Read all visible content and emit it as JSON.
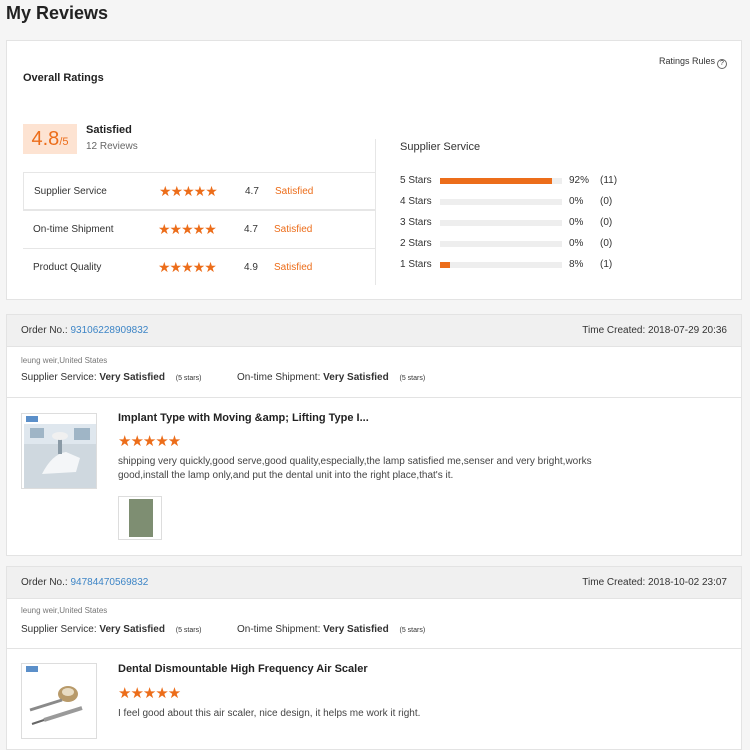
{
  "page": {
    "title": "My Reviews"
  },
  "overall": {
    "title": "Overall Ratings",
    "rules_label": "Ratings Rules",
    "score": "4.8",
    "outof": "/5",
    "label": "Satisfied",
    "count": "12 Reviews"
  },
  "metrics": [
    {
      "name": "Supplier Service",
      "stars": 4.7,
      "score": "4.7",
      "status": "Satisfied"
    },
    {
      "name": "On-time Shipment",
      "stars": 4.7,
      "score": "4.7",
      "status": "Satisfied"
    },
    {
      "name": "Product Quality",
      "stars": 4.9,
      "score": "4.9",
      "status": "Satisfied"
    }
  ],
  "distribution": {
    "title": "Supplier Service",
    "rows": [
      {
        "label": "5 Stars",
        "pct": "92%",
        "count": "(11)",
        "fraction": 0.92
      },
      {
        "label": "4 Stars",
        "pct": "0%",
        "count": "(0)",
        "fraction": 0
      },
      {
        "label": "3 Stars",
        "pct": "0%",
        "count": "(0)",
        "fraction": 0
      },
      {
        "label": "2 Stars",
        "pct": "0%",
        "count": "(0)",
        "fraction": 0
      },
      {
        "label": "1 Stars",
        "pct": "8%",
        "count": "(1)",
        "fraction": 0.08
      }
    ]
  },
  "orders": [
    {
      "order_label": "Order No.:",
      "order_no": "93106228909832",
      "time": "Time Created: 2018-07-29 20:36",
      "reviewer": "leung weir,United States",
      "service_label": "Supplier Service:",
      "service_value": "Very Satisfied",
      "service_stars": "(5 stars)",
      "shipment_label": "On-time Shipment:",
      "shipment_value": "Very Satisfied",
      "shipment_stars": "(5 stars)",
      "product_title": "Implant Type with Moving &amp; Lifting Type I...",
      "rating": 5,
      "review": "shipping very quickly,good serve,good quality,especially,the lamp satisfied me,senser and very bright,works good,install the lamp only,and put the dental unit into the right place,that's it."
    },
    {
      "order_label": "Order No.:",
      "order_no": "94784470569832",
      "time": "Time Created: 2018-10-02 23:07",
      "reviewer": "leung weir,United States",
      "service_label": "Supplier Service:",
      "service_value": "Very Satisfied",
      "service_stars": "(5 stars)",
      "shipment_label": "On-time Shipment:",
      "shipment_value": "Very Satisfied",
      "shipment_stars": "(5 stars)",
      "product_title": "Dental Dismountable High Frequency Air Scaler",
      "rating": 5,
      "review": "I feel good about this air scaler, nice design, it helps me work it right."
    }
  ],
  "colors": {
    "accent": "#ec6d1a",
    "link": "#3d85c6"
  }
}
